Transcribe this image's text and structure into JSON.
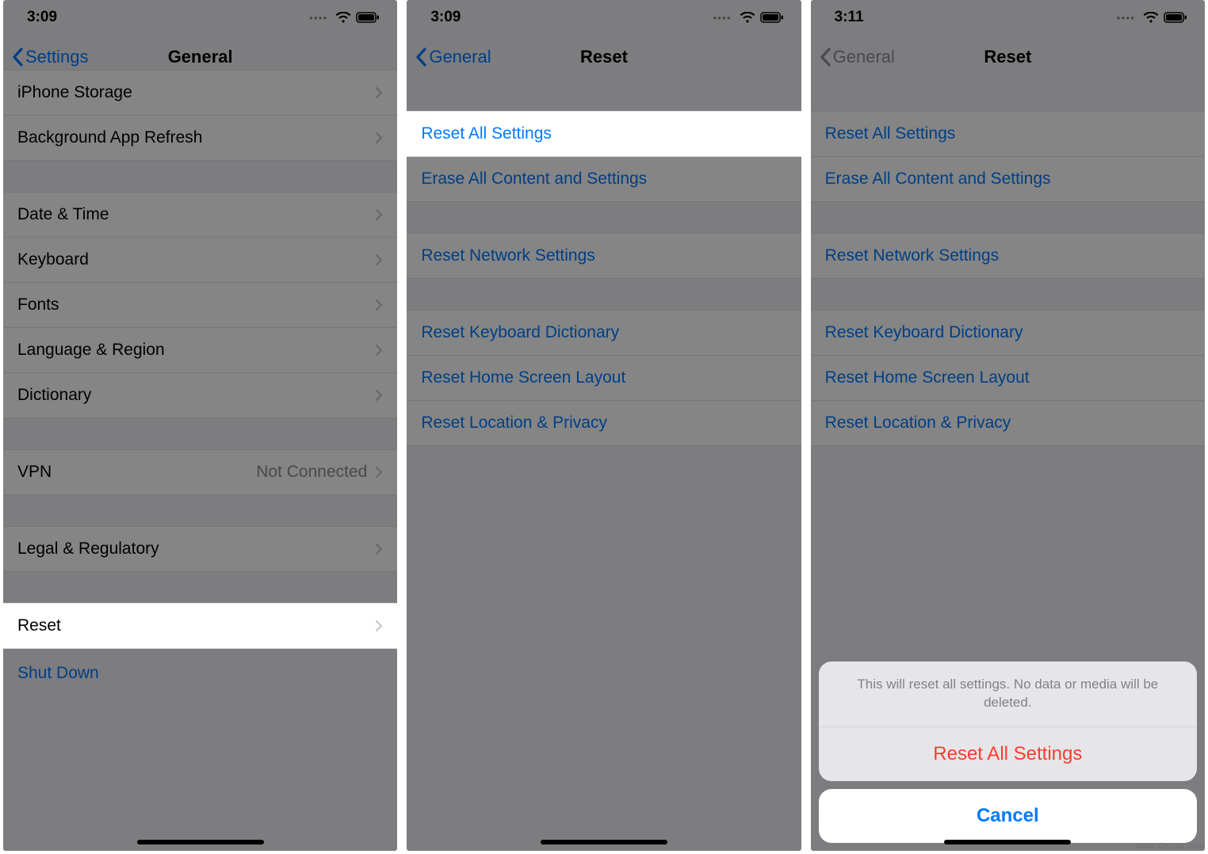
{
  "phone1": {
    "time": "3:09",
    "back": "Settings",
    "title": "General",
    "rows": {
      "iphone_storage": "iPhone Storage",
      "background_refresh": "Background App Refresh",
      "date_time": "Date & Time",
      "keyboard": "Keyboard",
      "fonts": "Fonts",
      "lang_region": "Language & Region",
      "dictionary": "Dictionary",
      "vpn": "VPN",
      "vpn_value": "Not Connected",
      "legal": "Legal & Regulatory",
      "reset": "Reset",
      "shutdown": "Shut Down"
    }
  },
  "phone2": {
    "time": "3:09",
    "back": "General",
    "title": "Reset",
    "rows": {
      "reset_all": "Reset All Settings",
      "erase_all": "Erase All Content and Settings",
      "reset_network": "Reset Network Settings",
      "reset_keyboard": "Reset Keyboard Dictionary",
      "reset_home": "Reset Home Screen Layout",
      "reset_location": "Reset Location & Privacy"
    }
  },
  "phone3": {
    "time": "3:11",
    "back": "General",
    "title": "Reset",
    "rows": {
      "reset_all": "Reset All Settings",
      "erase_all": "Erase All Content and Settings",
      "reset_network": "Reset Network Settings",
      "reset_keyboard": "Reset Keyboard Dictionary",
      "reset_home": "Reset Home Screen Layout",
      "reset_location": "Reset Location & Privacy"
    },
    "sheet": {
      "message": "This will reset all settings. No data or media will be deleted.",
      "action": "Reset All Settings",
      "cancel": "Cancel"
    }
  },
  "watermark": "www.deuaq.com"
}
